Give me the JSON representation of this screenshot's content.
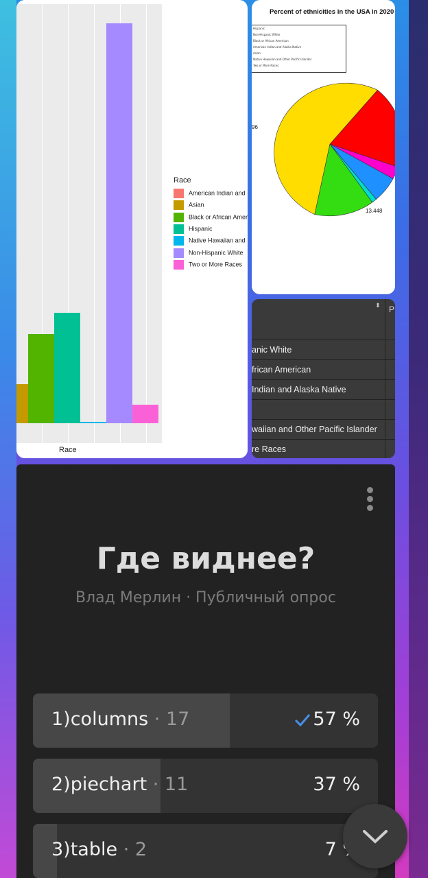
{
  "bar_chart": {
    "legend_title": "Race",
    "legend": [
      {
        "label": "American Indian and",
        "color": "#F8766D"
      },
      {
        "label": "Asian",
        "color": "#C49A00"
      },
      {
        "label": "Black or African Amer",
        "color": "#53B400"
      },
      {
        "label": "Hispanic",
        "color": "#00C094"
      },
      {
        "label": "Native Hawaiian and",
        "color": "#00B6EB"
      },
      {
        "label": "Non-Hispanic White",
        "color": "#A58AFF"
      },
      {
        "label": "Two or More Races",
        "color": "#FB61D7"
      }
    ],
    "xlabel": "Race"
  },
  "chart_data": {
    "type": "bar",
    "categories": [
      "Asian",
      "Black or African American",
      "Hispanic",
      "Native Hawaiian and Other Pacific Islander",
      "Non-Hispanic White",
      "Two or More Races"
    ],
    "values": [
      5.9,
      13.4,
      16.6,
      0.2,
      60.1,
      2.8
    ],
    "xlabel": "Race"
  },
  "pie_chart": {
    "title": "Percent of ethnicities in the USA in 2020",
    "legend": [
      "Hispanic",
      "Non-Hispanic White",
      "Black or African American",
      "American Indian and Alaska Native",
      "Asian",
      "Native Hawaiian and Other Pacific Islander",
      "Two or More Races"
    ],
    "label_left": "96",
    "label_bottom": "13.448"
  },
  "table": {
    "header_extra": "P",
    "rows": [
      "",
      "anic White",
      "frican American",
      " Indian and Alaska Native",
      "",
      "waiian and Other Pacific Islander",
      "re Races"
    ]
  },
  "poll": {
    "title": "Где виднее?",
    "subtitle": "Влад Мерлин · Публичный опрос",
    "options": [
      {
        "label": "1)columns",
        "count": "· 17",
        "percent": "57 %",
        "fraction": 0.57,
        "voted": true
      },
      {
        "label": "2)piechart",
        "count": "· 11",
        "percent": "37 %",
        "fraction": 0.37,
        "voted": false
      },
      {
        "label": "3)table",
        "count": "· 2",
        "percent": "7 %",
        "fraction": 0.07,
        "voted": false
      }
    ]
  },
  "colors": {
    "accent": "#4a8fe8",
    "poll_bg": "#222222"
  }
}
